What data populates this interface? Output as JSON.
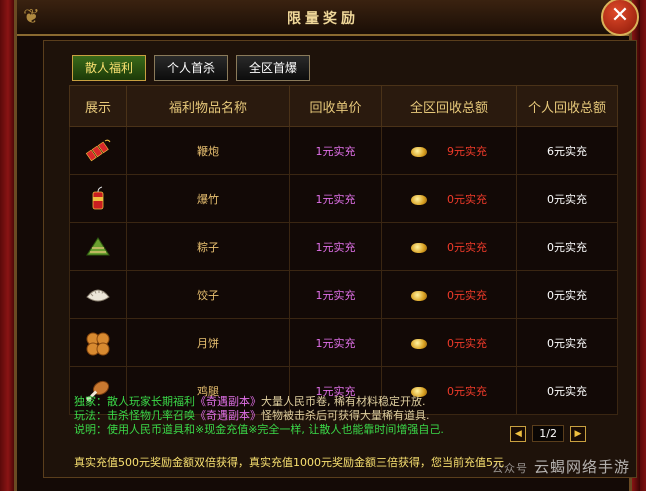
{
  "window": {
    "title": "限量奖励",
    "close_symbol": "✕"
  },
  "tabs": [
    {
      "label": "散人福利",
      "active": true
    },
    {
      "label": "个人首杀",
      "active": false
    },
    {
      "label": "全区首爆",
      "active": false
    }
  ],
  "table": {
    "headers": [
      "展示",
      "福利物品名称",
      "回收单价",
      "全区回收总额",
      "个人回收总额"
    ],
    "rows": [
      {
        "icon": "firecracker-string-icon",
        "name": "鞭炮",
        "unit_price": "1元实充",
        "server_total": "9元实充",
        "personal_total": "6元实充"
      },
      {
        "icon": "firecracker-icon",
        "name": "爆竹",
        "unit_price": "1元实充",
        "server_total": "0元实充",
        "personal_total": "0元实充"
      },
      {
        "icon": "zongzi-icon",
        "name": "粽子",
        "unit_price": "1元实充",
        "server_total": "0元实充",
        "personal_total": "0元实充"
      },
      {
        "icon": "dumpling-icon",
        "name": "饺子",
        "unit_price": "1元实充",
        "server_total": "0元实充",
        "personal_total": "0元实充"
      },
      {
        "icon": "mooncake-icon",
        "name": "月饼",
        "unit_price": "1元实充",
        "server_total": "0元实充",
        "personal_total": "0元实充"
      },
      {
        "icon": "drumstick-icon",
        "name": "鸡腿",
        "unit_price": "1元实充",
        "server_total": "0元实充",
        "personal_total": "0元实充"
      }
    ]
  },
  "notes": [
    {
      "label": "独家：",
      "a": "散人玩家长期福利",
      "hl": "《奇遇副本》",
      "b": "大量人民币卷, 稀有材料稳定开放."
    },
    {
      "label": "玩法：",
      "a": "击杀怪物几率召唤",
      "hl": "《奇遇副本》",
      "b": "怪物被击杀后可获得大量稀有道具."
    },
    {
      "label": "说明：",
      "a": "使用人民币道具和※现金充值※完全一样, 让散人也能靠时间增强自己.",
      "hl": "",
      "b": ""
    }
  ],
  "pager": {
    "prev": "◀",
    "page": "1/2",
    "next": "▶"
  },
  "footer": "真实充值500元奖励金额双倍获得，真实充值1000元奖励金额三倍获得，您当前充值5元",
  "watermark": {
    "small": "公众号",
    "text": "云蝎网络手游"
  }
}
